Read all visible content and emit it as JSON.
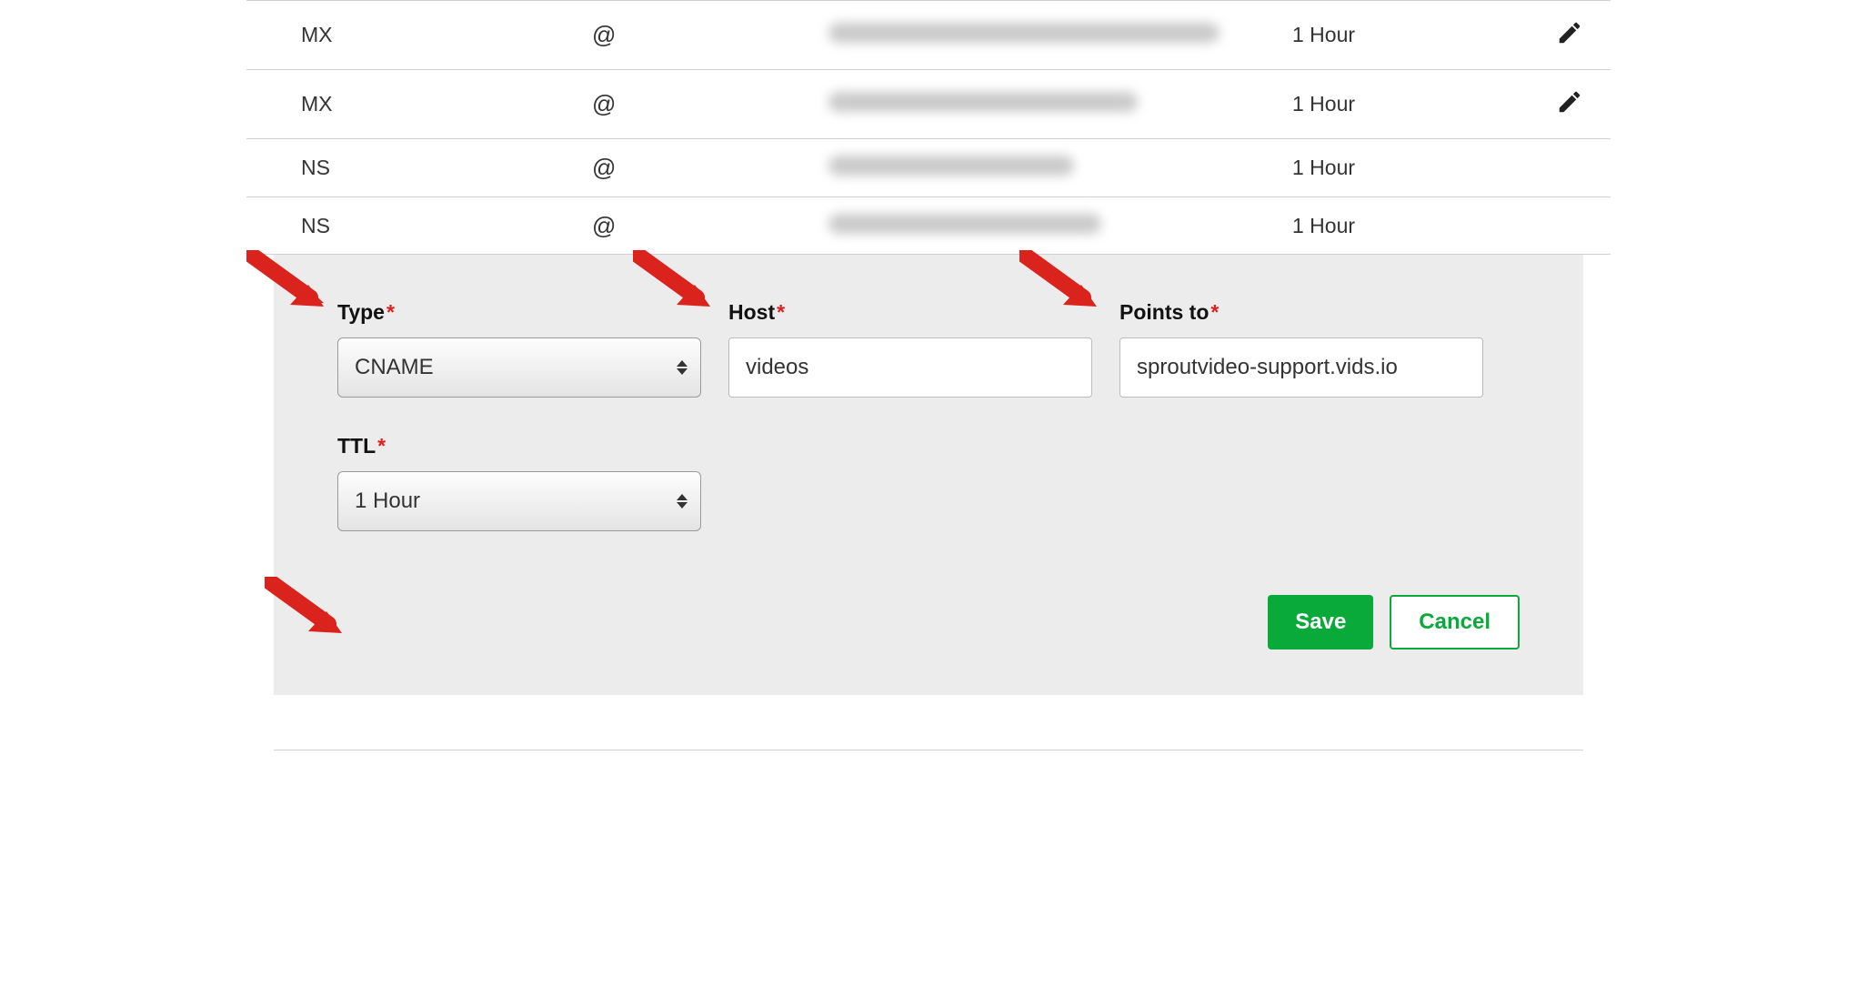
{
  "records": [
    {
      "type": "MX",
      "host": "@",
      "ttl": "1 Hour",
      "editable": true
    },
    {
      "type": "MX",
      "host": "@",
      "ttl": "1 Hour",
      "editable": true
    },
    {
      "type": "NS",
      "host": "@",
      "ttl": "1 Hour",
      "editable": false
    },
    {
      "type": "NS",
      "host": "@",
      "ttl": "1 Hour",
      "editable": false
    }
  ],
  "form": {
    "labels": {
      "type": "Type",
      "host": "Host",
      "points_to": "Points to",
      "ttl": "TTL",
      "required_mark": "*"
    },
    "type_value": "CNAME",
    "host_value": "videos",
    "points_to_value": "sproutvideo-support.vids.io",
    "ttl_value": "1 Hour",
    "buttons": {
      "save": "Save",
      "cancel": "Cancel"
    }
  }
}
